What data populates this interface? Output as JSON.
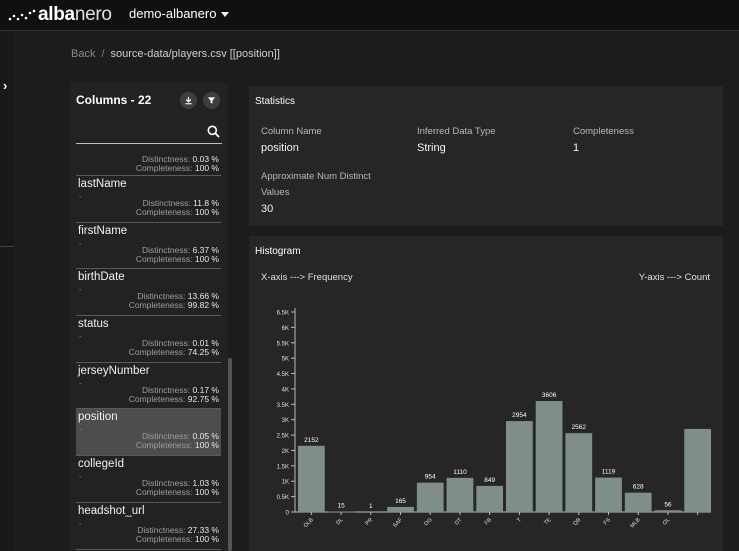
{
  "app": {
    "logo_bold": "alba",
    "logo_light": "nero",
    "project": "demo-albanero"
  },
  "breadcrumb": {
    "back": "Back",
    "sep": "/",
    "path": "source-data/players.csv [[position]]"
  },
  "columns_panel": {
    "title": "Columns - 22",
    "search_placeholder": "",
    "distinctness_label": "Distinctness:",
    "completeness_label": "Completeness:",
    "top_partial": {
      "distinctness": "0.03 %",
      "completeness": "100 %"
    },
    "items": [
      {
        "name": "lastName",
        "dash": "-",
        "distinctness": "11.8 %",
        "completeness": "100 %"
      },
      {
        "name": "firstName",
        "dash": "-",
        "distinctness": "6.37 %",
        "completeness": "100 %"
      },
      {
        "name": "birthDate",
        "dash": "-",
        "distinctness": "13.66 %",
        "completeness": "99.82 %"
      },
      {
        "name": "status",
        "dash": "-",
        "distinctness": "0.01 %",
        "completeness": "74.25 %"
      },
      {
        "name": "jerseyNumber",
        "dash": "-",
        "distinctness": "0.17 %",
        "completeness": "92.75 %"
      },
      {
        "name": "position",
        "dash": "-",
        "distinctness": "0.05 %",
        "completeness": "100 %"
      },
      {
        "name": "collegeId",
        "dash": "-",
        "distinctness": "1.03 %",
        "completeness": "100 %"
      },
      {
        "name": "headshot_url",
        "dash": "-",
        "distinctness": "27.33 %",
        "completeness": "100 %"
      }
    ]
  },
  "statistics": {
    "title": "Statistics",
    "column_name_label": "Column Name",
    "column_name_value": "position",
    "type_label": "Inferred Data Type",
    "type_value": "String",
    "completeness_label": "Completeness",
    "completeness_value": "1",
    "distinct_label_1": "Approximate Num Distinct",
    "distinct_label_2": "Values",
    "distinct_value": "30"
  },
  "histogram": {
    "title": "Histogram",
    "x_note": "X-axis ---> Frequency",
    "y_note": "Y-axis ---> Count"
  },
  "chart_data": {
    "type": "bar",
    "categories": [
      "OLB",
      "DL",
      "PR",
      "SAF",
      "OG",
      "DT",
      "FB",
      "T",
      "TE",
      "QB",
      "FS",
      "MLB",
      "OL",
      ""
    ],
    "values": [
      2152,
      15,
      1,
      165,
      954,
      1110,
      849,
      2954,
      3606,
      2562,
      1119,
      628,
      56,
      2700
    ],
    "value_labels": [
      "2152",
      "15",
      "1",
      "165",
      "954",
      "1110",
      "849",
      "2954",
      "3606",
      "2562",
      "1119",
      "628",
      "56",
      ""
    ],
    "yticks": [
      "0",
      "0.5K",
      "1K",
      "1.5K",
      "2K",
      "2.5K",
      "3K",
      "3.5K",
      "4K",
      "4.5K",
      "5K",
      "5.5K",
      "6K",
      "6.5K"
    ],
    "ylim": [
      0,
      6500
    ],
    "bar_color": "#7f8f87"
  }
}
